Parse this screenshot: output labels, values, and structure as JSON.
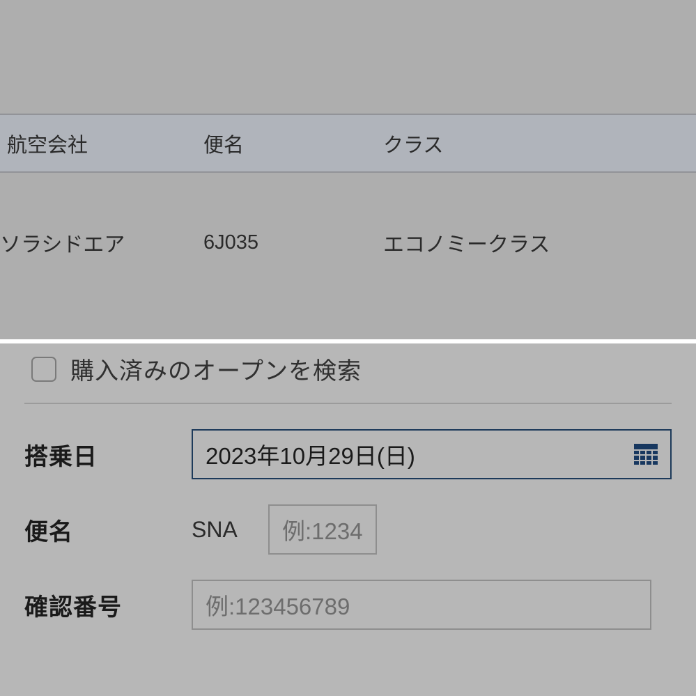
{
  "table": {
    "headers": {
      "airline": "航空会社",
      "flight": "便名",
      "class": "クラス"
    },
    "row": {
      "airline": "ソラシドエア",
      "flight": "6J035",
      "class": "エコノミークラス"
    }
  },
  "form": {
    "checkbox_label": "購入済みのオープンを検索",
    "fields": {
      "date": {
        "label": "搭乗日",
        "value": "2023年10月29日(日)"
      },
      "flight": {
        "label": "便名",
        "prefix": "SNA",
        "placeholder": "例:1234"
      },
      "confirm": {
        "label": "確認番号",
        "placeholder": "例:123456789"
      }
    }
  }
}
